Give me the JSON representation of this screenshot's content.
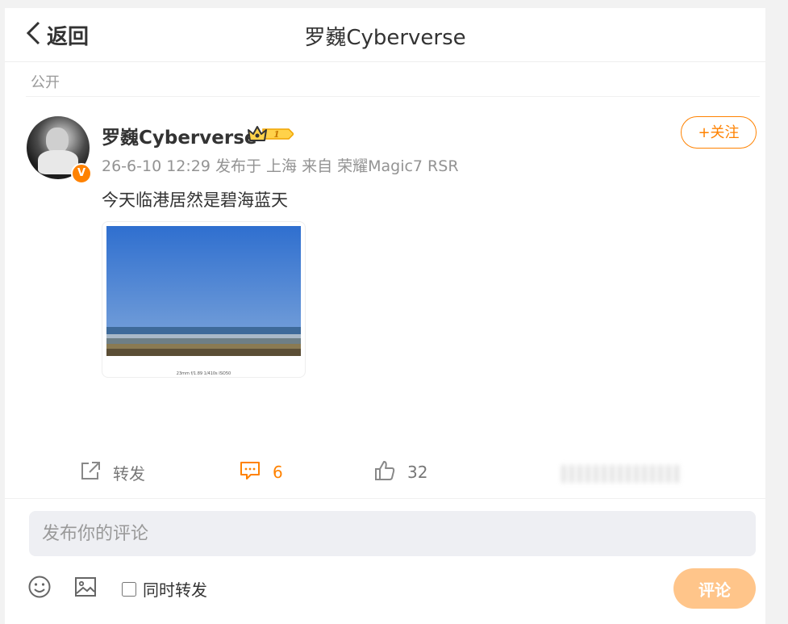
{
  "header": {
    "back_label": "返回",
    "title": "罗巍Cyberverse"
  },
  "visibility": "公开",
  "post": {
    "author": "罗巍Cyberverse",
    "level_badge": "1",
    "verified_badge": "V",
    "meta": "26-6-10 12:29 发布于 上海 来自 荣耀Magic7 RSR",
    "follow_label": "+关注",
    "text": "今天临港居然是碧海蓝天",
    "image_caption": "23mm f/1.89 1/410s ISO50"
  },
  "actions": {
    "repost_label": "转发",
    "comment_count": "6",
    "like_count": "32"
  },
  "composer": {
    "placeholder": "发布你的评论",
    "also_repost_label": "同时转发",
    "submit_label": "评论"
  },
  "colors": {
    "accent": "#ff8200",
    "submit_disabled": "#ffc58a",
    "input_bg": "#eeeff3"
  }
}
